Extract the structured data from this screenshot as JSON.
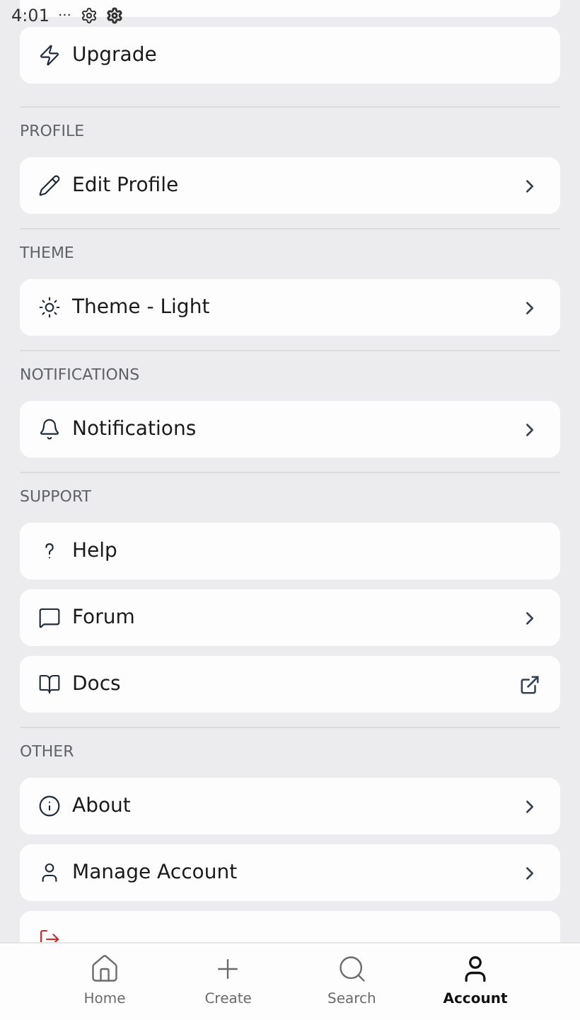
{
  "status_bar": {
    "time": "4:01",
    "more": "···"
  },
  "sections": [
    {
      "items": [
        {
          "kind": "plain"
        },
        {
          "label": "Upgrade",
          "kind": "plain"
        }
      ]
    },
    {
      "title": "PROFILE",
      "items": [
        {
          "label": "Edit Profile",
          "kind": "link"
        }
      ]
    },
    {
      "title": "THEME",
      "items": [
        {
          "label": "Theme - Light",
          "kind": "link"
        }
      ]
    },
    {
      "title": "NOTIFICATIONS",
      "items": [
        {
          "label": "Notifications",
          "kind": "link"
        }
      ]
    },
    {
      "title": "SUPPORT",
      "items": [
        {
          "label": "Help",
          "kind": "plain"
        },
        {
          "label": "Forum",
          "kind": "link"
        },
        {
          "label": "Docs",
          "kind": "external"
        }
      ]
    },
    {
      "title": "OTHER",
      "items": [
        {
          "label": "About",
          "kind": "link"
        },
        {
          "label": "Manage Account",
          "kind": "link"
        },
        {
          "kind": "danger"
        }
      ]
    }
  ],
  "nav": [
    {
      "label": "Home",
      "selected": false
    },
    {
      "label": "Create",
      "selected": false
    },
    {
      "label": "Search",
      "selected": false
    },
    {
      "label": "Account",
      "selected": true
    }
  ]
}
